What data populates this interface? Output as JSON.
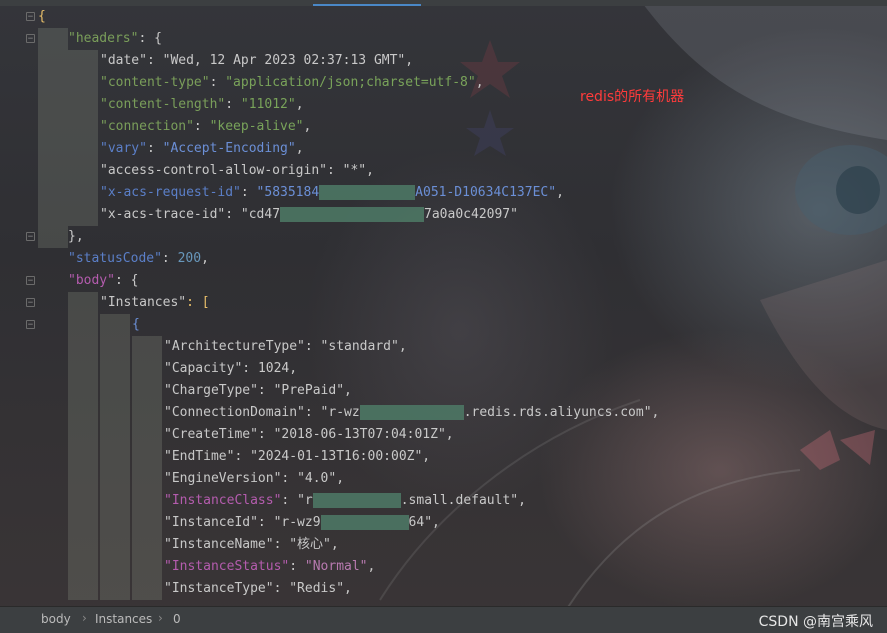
{
  "annotation": "redis的所有机器",
  "lines": [
    {
      "parts": [
        {
          "t": "{",
          "c": "brace"
        }
      ]
    },
    {
      "parts": [
        {
          "t": "\"headers\"",
          "c": "k-green"
        },
        {
          "t": ": {",
          "c": "p"
        }
      ]
    },
    {
      "parts": [
        {
          "t": "\"date\"",
          "c": "k-white"
        },
        {
          "t": ": ",
          "c": "p"
        },
        {
          "t": "\"Wed, 12 Apr 2023 02:37:13 GMT\"",
          "c": "p"
        },
        {
          "t": ",",
          "c": "p"
        }
      ]
    },
    {
      "parts": [
        {
          "t": "\"content-type\"",
          "c": "k-green"
        },
        {
          "t": ": ",
          "c": "p"
        },
        {
          "t": "\"application/json;charset=utf-8\"",
          "c": "s"
        },
        {
          "t": ",",
          "c": "p"
        }
      ]
    },
    {
      "parts": [
        {
          "t": "\"content-length\"",
          "c": "k-green"
        },
        {
          "t": ": ",
          "c": "p"
        },
        {
          "t": "\"11012\"",
          "c": "s"
        },
        {
          "t": ",",
          "c": "p"
        }
      ]
    },
    {
      "parts": [
        {
          "t": "\"connection\"",
          "c": "k-green"
        },
        {
          "t": ": ",
          "c": "p"
        },
        {
          "t": "\"keep-alive\"",
          "c": "s"
        },
        {
          "t": ",",
          "c": "p"
        }
      ]
    },
    {
      "parts": [
        {
          "t": "\"vary\"",
          "c": "k-blue"
        },
        {
          "t": ": ",
          "c": "p"
        },
        {
          "t": "\"Accept-Encoding\"",
          "c": "s-blue"
        },
        {
          "t": ",",
          "c": "p"
        }
      ]
    },
    {
      "parts": [
        {
          "t": "\"access-control-allow-origin\"",
          "c": "k-white"
        },
        {
          "t": ": ",
          "c": "p"
        },
        {
          "t": "\"*\"",
          "c": "p"
        },
        {
          "t": ",",
          "c": "p"
        }
      ]
    },
    {
      "parts": [
        {
          "t": "\"x-acs-request-id\"",
          "c": "k-blue"
        },
        {
          "t": ": ",
          "c": "p"
        },
        {
          "t": "\"5835184",
          "c": "s-blue"
        },
        {
          "mask": 12
        },
        {
          "t": "A051-D10634C137EC\"",
          "c": "s-blue"
        },
        {
          "t": ",",
          "c": "p"
        }
      ]
    },
    {
      "parts": [
        {
          "t": "\"x-acs-trace-id\"",
          "c": "k-white"
        },
        {
          "t": ": ",
          "c": "p"
        },
        {
          "t": "\"cd47",
          "c": "p"
        },
        {
          "mask": 18
        },
        {
          "t": "7a0a0c42097\"",
          "c": "p"
        }
      ]
    },
    {
      "parts": [
        {
          "t": "},",
          "c": "p"
        }
      ]
    },
    {
      "parts": [
        {
          "t": "\"statusCode\"",
          "c": "k-blue"
        },
        {
          "t": ": ",
          "c": "p"
        },
        {
          "t": "200",
          "c": "k-num"
        },
        {
          "t": ",",
          "c": "p"
        }
      ]
    },
    {
      "parts": [
        {
          "t": "\"body\"",
          "c": "k-magenta"
        },
        {
          "t": ": {",
          "c": "p"
        }
      ]
    },
    {
      "parts": [
        {
          "t": "\"Instances\"",
          "c": "k-white"
        },
        {
          "t": ": [",
          "c": "brace"
        }
      ]
    },
    {
      "parts": [
        {
          "t": "{",
          "c": "s-blue"
        }
      ]
    },
    {
      "parts": [
        {
          "t": "\"ArchitectureType\"",
          "c": "k-white"
        },
        {
          "t": ": ",
          "c": "p"
        },
        {
          "t": "\"standard\"",
          "c": "p"
        },
        {
          "t": ",",
          "c": "p"
        }
      ]
    },
    {
      "parts": [
        {
          "t": "\"Capacity\"",
          "c": "k-white"
        },
        {
          "t": ": ",
          "c": "p"
        },
        {
          "t": "1024",
          "c": "p"
        },
        {
          "t": ",",
          "c": "p"
        }
      ]
    },
    {
      "parts": [
        {
          "t": "\"ChargeType\"",
          "c": "k-white"
        },
        {
          "t": ": ",
          "c": "p"
        },
        {
          "t": "\"PrePaid\"",
          "c": "p"
        },
        {
          "t": ",",
          "c": "p"
        }
      ]
    },
    {
      "parts": [
        {
          "t": "\"ConnectionDomain\"",
          "c": "k-white"
        },
        {
          "t": ": ",
          "c": "p"
        },
        {
          "t": "\"r-wz",
          "c": "p"
        },
        {
          "mask": 13
        },
        {
          "t": ".redis.rds.aliyuncs.com\"",
          "c": "p"
        },
        {
          "t": ",",
          "c": "p"
        }
      ]
    },
    {
      "parts": [
        {
          "t": "\"CreateTime\"",
          "c": "k-white"
        },
        {
          "t": ": ",
          "c": "p"
        },
        {
          "t": "\"2018-06-13T07:04:01Z\"",
          "c": "p"
        },
        {
          "t": ",",
          "c": "p"
        }
      ]
    },
    {
      "parts": [
        {
          "t": "\"EndTime\"",
          "c": "k-white"
        },
        {
          "t": ": ",
          "c": "p"
        },
        {
          "t": "\"2024-01-13T16:00:00Z\"",
          "c": "p"
        },
        {
          "t": ",",
          "c": "p"
        }
      ]
    },
    {
      "parts": [
        {
          "t": "\"EngineVersion\"",
          "c": "k-white"
        },
        {
          "t": ": ",
          "c": "p"
        },
        {
          "t": "\"4.0\"",
          "c": "p"
        },
        {
          "t": ",",
          "c": "p"
        }
      ]
    },
    {
      "parts": [
        {
          "t": "\"InstanceClass\"",
          "c": "k-magenta"
        },
        {
          "t": ": ",
          "c": "p"
        },
        {
          "t": "\"r",
          "c": "p"
        },
        {
          "mask": 11
        },
        {
          "t": ".small.default\"",
          "c": "p"
        },
        {
          "t": ",",
          "c": "p"
        }
      ]
    },
    {
      "parts": [
        {
          "t": "\"InstanceId\"",
          "c": "k-white"
        },
        {
          "t": ": ",
          "c": "p"
        },
        {
          "t": "\"r-wz9",
          "c": "p"
        },
        {
          "mask": 11
        },
        {
          "t": "64\"",
          "c": "p"
        },
        {
          "t": ",",
          "c": "p"
        }
      ]
    },
    {
      "parts": [
        {
          "t": "\"InstanceName\"",
          "c": "k-white"
        },
        {
          "t": ": ",
          "c": "p"
        },
        {
          "t": "\"核心\"",
          "c": "p"
        },
        {
          "t": ",",
          "c": "p"
        }
      ]
    },
    {
      "parts": [
        {
          "t": "\"InstanceStatus\"",
          "c": "k-magenta"
        },
        {
          "t": ": ",
          "c": "p"
        },
        {
          "t": "\"Normal\"",
          "c": "s-mag"
        },
        {
          "t": ",",
          "c": "p"
        }
      ]
    },
    {
      "parts": [
        {
          "t": "\"InstanceType\"",
          "c": "k-white"
        },
        {
          "t": ": ",
          "c": "p"
        },
        {
          "t": "\"Redis\"",
          "c": "p"
        },
        {
          "t": ",",
          "c": "p"
        }
      ]
    }
  ],
  "breadcrumb": [
    "body",
    "Instances",
    "0"
  ],
  "watermark": "CSDN @南宫乘风",
  "colors": {
    "annotation": "#ff3b3b",
    "active_tab": "#4a88c7"
  }
}
